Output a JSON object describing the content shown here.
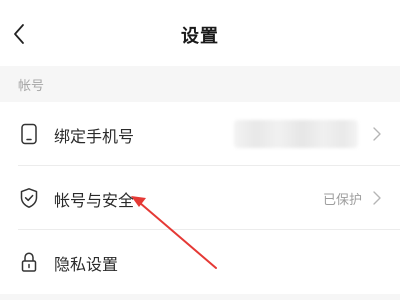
{
  "header": {
    "title": "设置",
    "back_icon": "chevron-left-icon"
  },
  "sections": [
    {
      "label": "帐号",
      "rows": [
        {
          "label": "绑定手机号",
          "icon": "phone-icon",
          "value": "",
          "value_obscured": true
        },
        {
          "label": "帐号与安全",
          "icon": "shield-check-icon",
          "value": "已保护"
        },
        {
          "label": "隐私设置",
          "icon": "lock-icon",
          "value": ""
        }
      ]
    }
  ],
  "annotation": {
    "color": "#e53935",
    "icon": "red-arrow-annotation",
    "points_to": "帐号与安全"
  }
}
